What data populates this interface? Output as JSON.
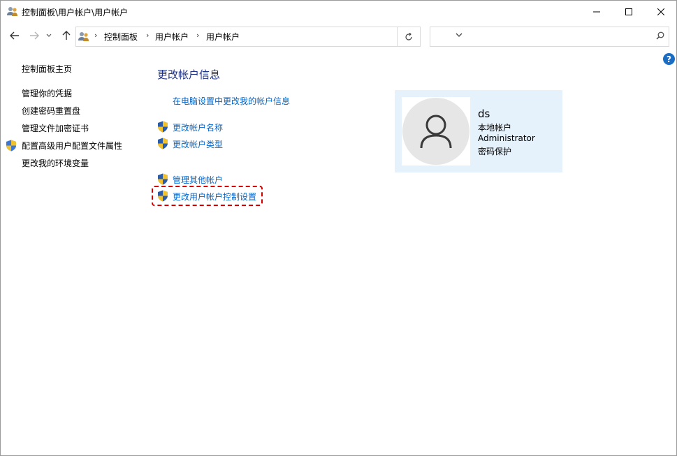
{
  "window": {
    "title": "控制面板\\用户帐户\\用户帐户",
    "title_icon": "user-accounts-icon",
    "controls": {
      "minimize": "minimize-icon",
      "maximize": "maximize-icon",
      "close": "close-icon"
    }
  },
  "nav": {
    "back": "back-arrow-icon",
    "forward": "forward-arrow-icon",
    "recent": "chevron-down-icon",
    "up": "up-arrow-icon",
    "breadcrumb": [
      "控制面板",
      "用户帐户",
      "用户帐户"
    ],
    "refresh": "refresh-icon",
    "search_placeholder": ""
  },
  "help": {
    "label": "?"
  },
  "sidebar": {
    "home": "控制面板主页",
    "items": [
      {
        "label": "管理你的凭据",
        "shield": false
      },
      {
        "label": "创建密码重置盘",
        "shield": false
      },
      {
        "label": "管理文件加密证书",
        "shield": false
      },
      {
        "label": "配置高级用户配置文件属性",
        "shield": true
      },
      {
        "label": "更改我的环境变量",
        "shield": false
      }
    ]
  },
  "main": {
    "heading": "更改帐户信息",
    "pc_settings_link": "在电脑设置中更改我的帐户信息",
    "links": [
      {
        "label": "更改帐户名称",
        "shield": true
      },
      {
        "label": "更改帐户类型",
        "shield": true
      },
      {
        "label": "管理其他帐户",
        "shield": true
      },
      {
        "label": "更改用户帐户控制设置",
        "shield": true,
        "highlighted": true
      }
    ]
  },
  "user": {
    "name": "ds",
    "account_type": "本地帐户",
    "role": "Administrator",
    "password_status": "密码保护"
  },
  "colors": {
    "link": "#0066cc",
    "heading": "#1e3287",
    "card_bg": "#e5f1fb",
    "highlight_border": "#d40000",
    "help_bg": "#1a6dc2"
  }
}
